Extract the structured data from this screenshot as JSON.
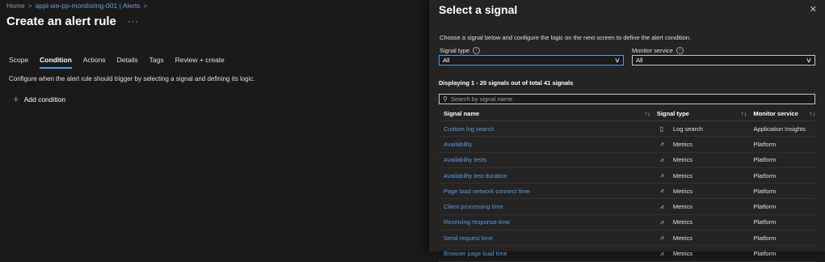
{
  "breadcrumb": {
    "home": "Home",
    "resource": "appi-we-pp-monitoring-001 | Alerts",
    "sep": ">"
  },
  "page": {
    "title": "Create an alert rule",
    "more": "···"
  },
  "tabs": [
    {
      "label": "Scope"
    },
    {
      "label": "Condition"
    },
    {
      "label": "Actions"
    },
    {
      "label": "Details"
    },
    {
      "label": "Tags"
    },
    {
      "label": "Review + create"
    }
  ],
  "condition": {
    "description": "Configure when the alert rule should trigger by selecting a signal and defining its logic.",
    "add_label": "Add condition"
  },
  "panel": {
    "title": "Select a signal",
    "intro": "Choose a signal below and configure the logic on the next screen to define the alert condition.",
    "signal_type_label": "Signal type",
    "signal_type_value": "All",
    "monitor_service_label": "Monitor service",
    "monitor_service_value": "All",
    "displaying": "Displaying 1 - 20 signals out of total 41 signals",
    "search_placeholder": "Search by signal name",
    "columns": {
      "name": "Signal name",
      "type": "Signal type",
      "service": "Monitor service"
    },
    "rows": [
      {
        "name": "Custom log search",
        "type": "Log search",
        "service": "Application Insights"
      },
      {
        "name": "Availability",
        "type": "Metrics",
        "service": "Platform"
      },
      {
        "name": "Availability tests",
        "type": "Metrics",
        "service": "Platform"
      },
      {
        "name": "Availability test duration",
        "type": "Metrics",
        "service": "Platform"
      },
      {
        "name": "Page load network connect time",
        "type": "Metrics",
        "service": "Platform"
      },
      {
        "name": "Client processing time",
        "type": "Metrics",
        "service": "Platform"
      },
      {
        "name": "Receiving response time",
        "type": "Metrics",
        "service": "Platform"
      },
      {
        "name": "Send request time",
        "type": "Metrics",
        "service": "Platform"
      },
      {
        "name": "Browser page load time",
        "type": "Metrics",
        "service": "Platform"
      }
    ]
  },
  "colors": {
    "accent": "#4f9ee8",
    "background": "#1b1a19",
    "panel": "#252423"
  }
}
